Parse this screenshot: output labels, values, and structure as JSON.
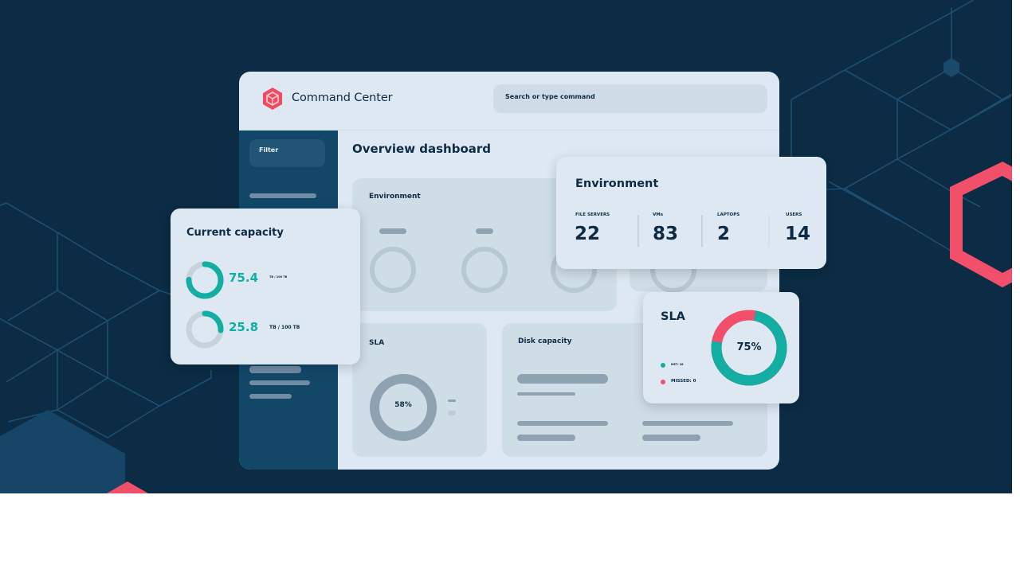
{
  "app": {
    "title": "Command Center",
    "logo_icon": "cube-hexagon-icon",
    "search_placeholder": "Search or type command"
  },
  "sidebar": {
    "filter_label": "Filter"
  },
  "page": {
    "title": "Overview dashboard"
  },
  "panels": {
    "environment_title": "Environment",
    "sla_title": "SLA",
    "sla_value": "58%",
    "disk_title": "Disk capacity"
  },
  "capacity_card": {
    "title": "Current capacity",
    "items": [
      {
        "value": "75.4",
        "unit": "TB / 100 TB",
        "fraction": 0.754
      },
      {
        "value": "25.8",
        "unit": "TB / 100 TB",
        "fraction": 0.258
      }
    ]
  },
  "environment_card": {
    "title": "Environment",
    "stats": [
      {
        "label": "FILE SERVERS",
        "value": "22"
      },
      {
        "label": "VMs",
        "value": "83"
      },
      {
        "label": "LAPTOPS",
        "value": "2"
      },
      {
        "label": "USERS",
        "value": "14"
      }
    ]
  },
  "sla_card": {
    "title": "SLA",
    "value": "75%",
    "fraction": 0.75,
    "legend": [
      {
        "label": "MET: 28",
        "color": "#12ada3"
      },
      {
        "label": "MISSED: 0",
        "color": "#f2506a"
      }
    ]
  },
  "colors": {
    "background": "#0b2c44",
    "accent_teal": "#12ada3",
    "accent_red": "#f2506a",
    "sidebar": "#134768"
  }
}
